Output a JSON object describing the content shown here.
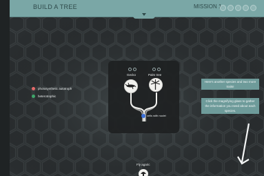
{
  "header": {
    "title": "BUILD A TREE",
    "mission_label": "MISSION 1",
    "mission_progress_count": 5
  },
  "legend": {
    "items": [
      {
        "label": "photosynthetic autotroph",
        "color": "#e36a6a"
      },
      {
        "label": "heterotrophic",
        "color": "#3fa56a"
      }
    ]
  },
  "tree": {
    "species": [
      {
        "name": "Gecko"
      },
      {
        "name": "Palm tree"
      }
    ],
    "trait": {
      "label": "cells with nuclei",
      "color": "#3a6fd8"
    }
  },
  "hints": {
    "line1": "Here's another species and two more traits!",
    "line2": "Click the magnifying glass to gather the information you need about each species."
  },
  "incoming_species": {
    "name": "Fly agaric"
  },
  "colors": {
    "bar": "#7aa7a6",
    "hint_bg": "#6e9b9a",
    "background": "#2e3335"
  }
}
